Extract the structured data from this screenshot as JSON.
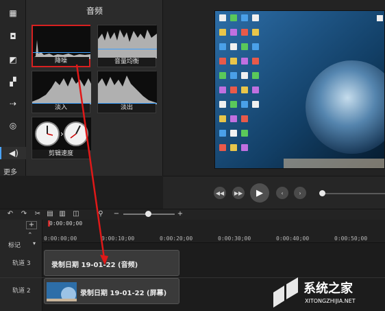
{
  "rail": {
    "more_label": "更多"
  },
  "fx_panel": {
    "title": "音频",
    "items": [
      {
        "label": "降噪"
      },
      {
        "label": "音量均衡"
      },
      {
        "label": "淡入"
      },
      {
        "label": "淡出"
      },
      {
        "label": "剪辑速度"
      }
    ]
  },
  "timeline": {
    "playhead_time": "0:00:00;00",
    "ticks": [
      "0:00:00;00",
      "0:00:10;00",
      "0:00:20;00",
      "0:00:30;00",
      "0:00:40;00",
      "0:00:50;00"
    ],
    "marker_label": "标记",
    "tracks": [
      {
        "name": "轨道 3",
        "clip_label": "录制日期 19-01-22 (音频)"
      },
      {
        "name": "轨道 2",
        "clip_label": "录制日期 19-01-22 (屏幕)"
      }
    ]
  },
  "watermark": {
    "brand": "系统之家",
    "url": "XITONGZHIJIA.NET"
  },
  "colors": {
    "highlight": "#d92020",
    "accent": "#4aa3ff"
  }
}
